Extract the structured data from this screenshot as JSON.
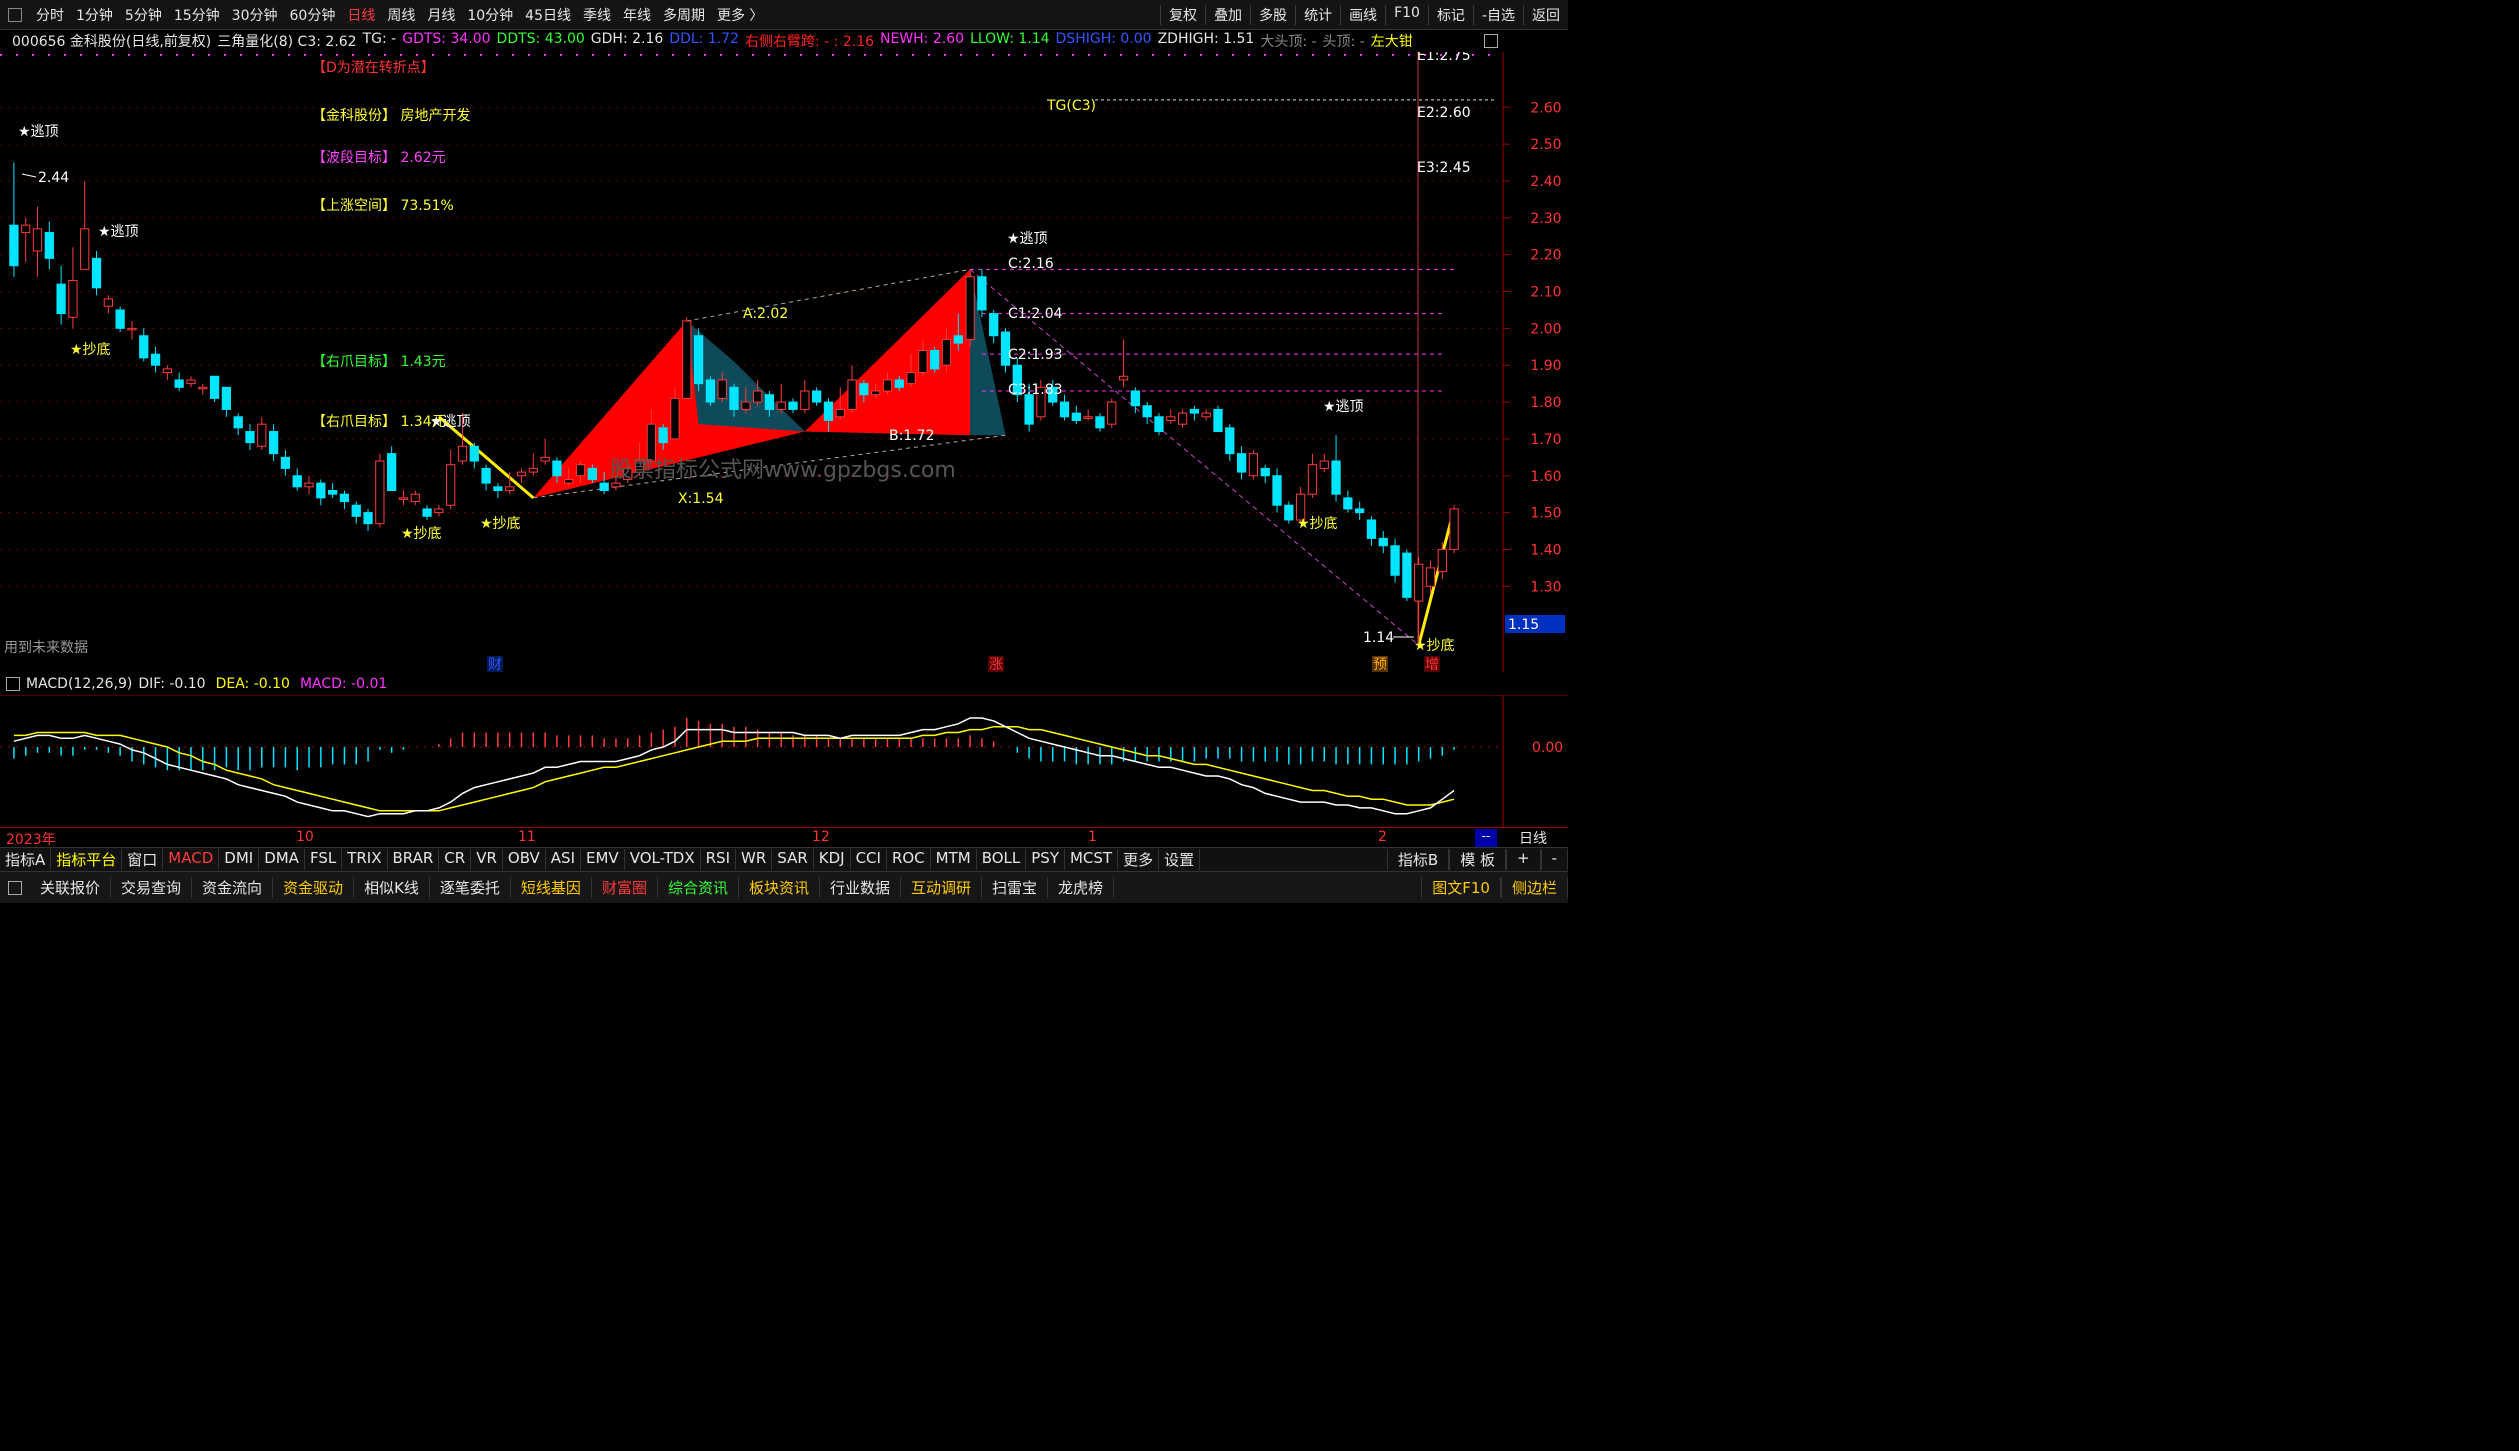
{
  "toolbar": {
    "periods": [
      "分时",
      "1分钟",
      "5分钟",
      "15分钟",
      "30分钟",
      "60分钟",
      "日线",
      "周线",
      "月线",
      "10分钟",
      "45日线",
      "季线",
      "年线",
      "多周期",
      "更多 〉"
    ],
    "active": "日线",
    "right": [
      "复权",
      "叠加",
      "多股",
      "统计",
      "画线",
      "F10",
      "标记",
      "-自选",
      "返回"
    ]
  },
  "info": [
    {
      "t": "000656 金科股份(日线,前复权)",
      "c": "#e6e6e6"
    },
    {
      "t": "三角量化(8) C3: 2.62",
      "c": "#e6e6e6"
    },
    {
      "t": "TG: -",
      "c": "#e6e6e6"
    },
    {
      "t": "GDTS: 34.00",
      "c": "#ff33ff"
    },
    {
      "t": "DDTS: 43.00",
      "c": "#33ff33"
    },
    {
      "t": "GDH: 2.16",
      "c": "#e6e6e6"
    },
    {
      "t": "DDL: 1.72",
      "c": "#3355ff"
    },
    {
      "t": "右侧右臂跨: - : 2.16",
      "c": "#ff2222"
    },
    {
      "t": "NEWH: 2.60",
      "c": "#ff33ff"
    },
    {
      "t": "LLOW: 1.14",
      "c": "#33ff33"
    },
    {
      "t": "DSHIGH: 0.00",
      "c": "#3355ff"
    },
    {
      "t": "ZDHIGH: 1.51",
      "c": "#e6e6e6"
    },
    {
      "t": "大头顶: -",
      "c": "#888888"
    },
    {
      "t": "头顶: -",
      "c": "#888888"
    },
    {
      "t": "左大钳",
      "c": "#ffff00"
    }
  ],
  "textlabels": [
    {
      "t": "【D为潜在转折点】",
      "c": "#ff3333"
    },
    {
      "t": "【金科股份】 房地产开发",
      "c": "#ffff33"
    },
    {
      "t": "【波段目标】 2.62元",
      "c": "#ff44ff"
    },
    {
      "t": "【上涨空间】 73.51%",
      "c": "#ffff33"
    },
    {
      "t": "【右爪目标】 1.43元",
      "c": "#33ff33"
    },
    {
      "t": "【右爪目标】 1.34元",
      "c": "#ffff33"
    }
  ],
  "future_note": "用到未来数据",
  "watermark": "股票指标公式网www.gpzbgs.com",
  "signals": {
    "top": "★逃顶",
    "bottom": "★抄底"
  },
  "marks": [
    "财",
    "涨",
    "预",
    "增"
  ],
  "points": {
    "X": "X:1.54",
    "A": "A:2.02",
    "B": "B:1.72",
    "C": "C:2.16",
    "C1": "C1:2.04",
    "C2": "C2:1.93",
    "C3": "C3:1.83",
    "TG": "TG(C3)",
    "E2": "E2:2.60",
    "E3": "E3:2.45",
    "hi": "2.44",
    "lo": "1.14",
    "E1": "E1:2.75"
  },
  "price_box": "1.15",
  "macd": {
    "label": "MACD(12,26,9)",
    "dif": "DIF: -0.10",
    "dea": "DEA: -0.10",
    "macd": "MACD: -0.01",
    "ytick": "0.00"
  },
  "dates": [
    "2023年",
    "10",
    "11",
    "12",
    "1",
    "2"
  ],
  "date_right": "日线",
  "date_right_small": "--",
  "indicators": [
    "指标A",
    "指标平台",
    "窗口",
    "MACD",
    "DMI",
    "DMA",
    "FSL",
    "TRIX",
    "BRAR",
    "CR",
    "VR",
    "OBV",
    "ASI",
    "EMV",
    "VOL-TDX",
    "RSI",
    "WR",
    "SAR",
    "KDJ",
    "CCI",
    "ROC",
    "MTM",
    "BOLL",
    "PSY",
    "MCST",
    "更多",
    "设置"
  ],
  "indicators_right": [
    "指标B",
    "模 板",
    "+",
    "-"
  ],
  "functions": [
    "关联报价",
    "交易查询",
    "资金流向",
    "资金驱动",
    "相似K线",
    "逐笔委托",
    "短线基因",
    "财富圈",
    "综合资讯",
    "板块资讯",
    "行业数据",
    "互动调研",
    "扫雷宝",
    "龙虎榜"
  ],
  "functions_right": [
    "图文F10",
    "侧边栏"
  ],
  "chart_data": {
    "type": "candlestick",
    "title": "000656 金科股份(日线,前复权)",
    "ylim": [
      1.1,
      2.75
    ],
    "yticks": [
      1.3,
      1.4,
      1.5,
      1.6,
      1.7,
      1.8,
      1.9,
      2.0,
      2.1,
      2.2,
      2.3,
      2.4,
      2.5,
      2.6
    ],
    "candles": [
      [
        2.28,
        2.17,
        2.45,
        2.14
      ],
      [
        2.26,
        2.28,
        2.3,
        2.18
      ],
      [
        2.21,
        2.27,
        2.33,
        2.14
      ],
      [
        2.26,
        2.19,
        2.29,
        2.16
      ],
      [
        2.12,
        2.04,
        2.17,
        2.01
      ],
      [
        2.03,
        2.13,
        2.22,
        2.0
      ],
      [
        2.16,
        2.27,
        2.4,
        2.16
      ],
      [
        2.19,
        2.11,
        2.21,
        2.09
      ],
      [
        2.06,
        2.08,
        2.09,
        2.04
      ],
      [
        2.05,
        2.0,
        2.06,
        1.99
      ],
      [
        2.0,
        2.0,
        2.02,
        1.97
      ],
      [
        1.98,
        1.92,
        2.0,
        1.91
      ],
      [
        1.93,
        1.9,
        1.95,
        1.88
      ],
      [
        1.88,
        1.89,
        1.9,
        1.86
      ],
      [
        1.86,
        1.84,
        1.88,
        1.83
      ],
      [
        1.85,
        1.86,
        1.87,
        1.84
      ],
      [
        1.84,
        1.84,
        1.85,
        1.82
      ],
      [
        1.87,
        1.81,
        1.87,
        1.8
      ],
      [
        1.84,
        1.78,
        1.84,
        1.76
      ],
      [
        1.76,
        1.73,
        1.77,
        1.71
      ],
      [
        1.72,
        1.69,
        1.74,
        1.67
      ],
      [
        1.68,
        1.74,
        1.76,
        1.67
      ],
      [
        1.72,
        1.66,
        1.74,
        1.64
      ],
      [
        1.65,
        1.62,
        1.67,
        1.6
      ],
      [
        1.6,
        1.57,
        1.62,
        1.56
      ],
      [
        1.57,
        1.58,
        1.6,
        1.55
      ],
      [
        1.58,
        1.54,
        1.59,
        1.52
      ],
      [
        1.56,
        1.55,
        1.58,
        1.54
      ],
      [
        1.55,
        1.53,
        1.56,
        1.51
      ],
      [
        1.52,
        1.49,
        1.53,
        1.47
      ],
      [
        1.5,
        1.47,
        1.51,
        1.45
      ],
      [
        1.47,
        1.64,
        1.66,
        1.46
      ],
      [
        1.66,
        1.56,
        1.68,
        1.56
      ],
      [
        1.54,
        1.54,
        1.56,
        1.52
      ],
      [
        1.53,
        1.55,
        1.56,
        1.52
      ],
      [
        1.51,
        1.49,
        1.52,
        1.48
      ],
      [
        1.5,
        1.51,
        1.52,
        1.49
      ],
      [
        1.52,
        1.63,
        1.67,
        1.51
      ],
      [
        1.64,
        1.68,
        1.77,
        1.63
      ],
      [
        1.68,
        1.64,
        1.69,
        1.62
      ],
      [
        1.62,
        1.58,
        1.63,
        1.56
      ],
      [
        1.57,
        1.56,
        1.58,
        1.54
      ],
      [
        1.56,
        1.57,
        1.61,
        1.55
      ],
      [
        1.6,
        1.61,
        1.62,
        1.58
      ],
      [
        1.61,
        1.62,
        1.66,
        1.6
      ],
      [
        1.64,
        1.65,
        1.7,
        1.63
      ],
      [
        1.64,
        1.6,
        1.65,
        1.58
      ],
      [
        1.58,
        1.59,
        1.62,
        1.57
      ],
      [
        1.6,
        1.63,
        1.64,
        1.58
      ],
      [
        1.62,
        1.59,
        1.63,
        1.58
      ],
      [
        1.58,
        1.56,
        1.61,
        1.55
      ],
      [
        1.57,
        1.58,
        1.6,
        1.56
      ],
      [
        1.59,
        1.62,
        1.64,
        1.58
      ],
      [
        1.61,
        1.64,
        1.69,
        1.6
      ],
      [
        1.64,
        1.74,
        1.78,
        1.64
      ],
      [
        1.73,
        1.69,
        1.74,
        1.67
      ],
      [
        1.7,
        1.81,
        1.84,
        1.7
      ],
      [
        1.81,
        2.02,
        2.03,
        1.81
      ],
      [
        1.98,
        1.85,
        2.0,
        1.83
      ],
      [
        1.86,
        1.8,
        1.87,
        1.79
      ],
      [
        1.81,
        1.86,
        1.88,
        1.8
      ],
      [
        1.84,
        1.78,
        1.85,
        1.76
      ],
      [
        1.78,
        1.8,
        1.84,
        1.77
      ],
      [
        1.8,
        1.83,
        1.86,
        1.79
      ],
      [
        1.82,
        1.78,
        1.83,
        1.76
      ],
      [
        1.78,
        1.8,
        1.85,
        1.77
      ],
      [
        1.8,
        1.78,
        1.81,
        1.77
      ],
      [
        1.78,
        1.83,
        1.86,
        1.77
      ],
      [
        1.83,
        1.8,
        1.84,
        1.79
      ],
      [
        1.8,
        1.75,
        1.81,
        1.72
      ],
      [
        1.76,
        1.78,
        1.84,
        1.75
      ],
      [
        1.78,
        1.86,
        1.9,
        1.77
      ],
      [
        1.85,
        1.82,
        1.86,
        1.8
      ],
      [
        1.82,
        1.83,
        1.85,
        1.81
      ],
      [
        1.83,
        1.86,
        1.88,
        1.82
      ],
      [
        1.86,
        1.84,
        1.87,
        1.83
      ],
      [
        1.85,
        1.88,
        1.93,
        1.84
      ],
      [
        1.88,
        1.94,
        1.97,
        1.87
      ],
      [
        1.94,
        1.89,
        1.95,
        1.88
      ],
      [
        1.9,
        1.97,
        2.0,
        1.88
      ],
      [
        1.98,
        1.96,
        2.04,
        1.94
      ],
      [
        1.97,
        2.14,
        2.16,
        1.95
      ],
      [
        2.14,
        2.05,
        2.16,
        2.03
      ],
      [
        2.04,
        1.98,
        2.05,
        1.96
      ],
      [
        1.99,
        1.9,
        2.0,
        1.88
      ],
      [
        1.9,
        1.82,
        1.92,
        1.8
      ],
      [
        1.82,
        1.74,
        1.85,
        1.72
      ],
      [
        1.76,
        1.84,
        1.86,
        1.75
      ],
      [
        1.84,
        1.8,
        1.86,
        1.79
      ],
      [
        1.8,
        1.76,
        1.82,
        1.75
      ],
      [
        1.77,
        1.75,
        1.79,
        1.74
      ],
      [
        1.76,
        1.76,
        1.78,
        1.75
      ],
      [
        1.76,
        1.73,
        1.77,
        1.72
      ],
      [
        1.74,
        1.8,
        1.81,
        1.73
      ],
      [
        1.86,
        1.87,
        1.97,
        1.84
      ],
      [
        1.83,
        1.79,
        1.84,
        1.77
      ],
      [
        1.79,
        1.76,
        1.8,
        1.74
      ],
      [
        1.76,
        1.72,
        1.77,
        1.71
      ],
      [
        1.75,
        1.76,
        1.78,
        1.74
      ],
      [
        1.74,
        1.77,
        1.78,
        1.73
      ],
      [
        1.78,
        1.77,
        1.79,
        1.75
      ],
      [
        1.76,
        1.77,
        1.78,
        1.75
      ],
      [
        1.78,
        1.72,
        1.79,
        1.72
      ],
      [
        1.73,
        1.66,
        1.74,
        1.64
      ],
      [
        1.66,
        1.61,
        1.68,
        1.59
      ],
      [
        1.6,
        1.66,
        1.67,
        1.59
      ],
      [
        1.62,
        1.6,
        1.63,
        1.58
      ],
      [
        1.6,
        1.52,
        1.62,
        1.5
      ],
      [
        1.52,
        1.48,
        1.53,
        1.47
      ],
      [
        1.48,
        1.55,
        1.57,
        1.47
      ],
      [
        1.55,
        1.63,
        1.66,
        1.54
      ],
      [
        1.62,
        1.64,
        1.66,
        1.61
      ],
      [
        1.64,
        1.55,
        1.71,
        1.53
      ],
      [
        1.54,
        1.51,
        1.56,
        1.5
      ],
      [
        1.51,
        1.5,
        1.53,
        1.48
      ],
      [
        1.48,
        1.43,
        1.49,
        1.41
      ],
      [
        1.43,
        1.41,
        1.45,
        1.39
      ],
      [
        1.41,
        1.33,
        1.43,
        1.31
      ],
      [
        1.39,
        1.27,
        1.4,
        1.26
      ],
      [
        1.26,
        1.36,
        1.38,
        1.14
      ],
      [
        1.3,
        1.35,
        1.37,
        1.28
      ],
      [
        1.34,
        1.4,
        1.42,
        1.32
      ],
      [
        1.4,
        1.51,
        1.52,
        1.39
      ]
    ],
    "macd_hist": [
      -0.04,
      -0.03,
      -0.02,
      -0.02,
      -0.03,
      -0.03,
      -0.01,
      -0.01,
      -0.02,
      -0.03,
      -0.05,
      -0.06,
      -0.07,
      -0.08,
      -0.08,
      -0.08,
      -0.08,
      -0.08,
      -0.07,
      -0.08,
      -0.08,
      -0.07,
      -0.07,
      -0.07,
      -0.08,
      -0.07,
      -0.07,
      -0.06,
      -0.06,
      -0.06,
      -0.05,
      -0.01,
      -0.02,
      -0.01,
      0.0,
      0.0,
      0.01,
      0.03,
      0.05,
      0.05,
      0.05,
      0.05,
      0.05,
      0.05,
      0.05,
      0.05,
      0.04,
      0.04,
      0.04,
      0.04,
      0.03,
      0.03,
      0.03,
      0.04,
      0.05,
      0.06,
      0.07,
      0.1,
      0.09,
      0.08,
      0.08,
      0.07,
      0.07,
      0.06,
      0.05,
      0.05,
      0.04,
      0.04,
      0.04,
      0.03,
      0.03,
      0.03,
      0.03,
      0.03,
      0.03,
      0.03,
      0.03,
      0.03,
      0.03,
      0.03,
      0.03,
      0.04,
      0.03,
      0.02,
      0.0,
      -0.02,
      -0.04,
      -0.05,
      -0.05,
      -0.05,
      -0.06,
      -0.06,
      -0.06,
      -0.06,
      -0.05,
      -0.05,
      -0.05,
      -0.05,
      -0.05,
      -0.05,
      -0.05,
      -0.04,
      -0.04,
      -0.04,
      -0.05,
      -0.05,
      -0.05,
      -0.05,
      -0.06,
      -0.06,
      -0.05,
      -0.05,
      -0.06,
      -0.06,
      -0.06,
      -0.06,
      -0.06,
      -0.06,
      -0.06,
      -0.05,
      -0.04,
      -0.03,
      -0.01
    ],
    "macd_dif": [
      0.02,
      0.03,
      0.04,
      0.04,
      0.03,
      0.03,
      0.04,
      0.03,
      0.02,
      0.01,
      -0.01,
      -0.02,
      -0.04,
      -0.06,
      -0.07,
      -0.08,
      -0.09,
      -0.1,
      -0.11,
      -0.13,
      -0.14,
      -0.15,
      -0.16,
      -0.17,
      -0.19,
      -0.2,
      -0.21,
      -0.22,
      -0.22,
      -0.23,
      -0.24,
      -0.23,
      -0.23,
      -0.23,
      -0.22,
      -0.22,
      -0.21,
      -0.19,
      -0.16,
      -0.14,
      -0.13,
      -0.12,
      -0.11,
      -0.1,
      -0.09,
      -0.07,
      -0.07,
      -0.06,
      -0.05,
      -0.05,
      -0.05,
      -0.05,
      -0.04,
      -0.03,
      -0.01,
      0.0,
      0.02,
      0.06,
      0.06,
      0.06,
      0.06,
      0.05,
      0.05,
      0.05,
      0.05,
      0.05,
      0.05,
      0.04,
      0.04,
      0.04,
      0.03,
      0.04,
      0.04,
      0.04,
      0.04,
      0.04,
      0.05,
      0.06,
      0.06,
      0.07,
      0.08,
      0.1,
      0.1,
      0.09,
      0.07,
      0.05,
      0.03,
      0.02,
      0.01,
      0.0,
      -0.01,
      -0.02,
      -0.03,
      -0.03,
      -0.04,
      -0.05,
      -0.06,
      -0.07,
      -0.07,
      -0.08,
      -0.09,
      -0.1,
      -0.1,
      -0.11,
      -0.13,
      -0.14,
      -0.16,
      -0.17,
      -0.18,
      -0.19,
      -0.19,
      -0.19,
      -0.2,
      -0.2,
      -0.21,
      -0.21,
      -0.22,
      -0.23,
      -0.23,
      -0.22,
      -0.21,
      -0.18,
      -0.15
    ],
    "macd_dea": [
      0.04,
      0.04,
      0.05,
      0.05,
      0.05,
      0.05,
      0.05,
      0.04,
      0.04,
      0.04,
      0.03,
      0.02,
      0.01,
      0.0,
      -0.02,
      -0.03,
      -0.05,
      -0.06,
      -0.08,
      -0.09,
      -0.1,
      -0.11,
      -0.13,
      -0.14,
      -0.15,
      -0.16,
      -0.17,
      -0.18,
      -0.19,
      -0.2,
      -0.21,
      -0.22,
      -0.22,
      -0.22,
      -0.22,
      -0.22,
      -0.22,
      -0.21,
      -0.2,
      -0.19,
      -0.18,
      -0.17,
      -0.16,
      -0.15,
      -0.14,
      -0.12,
      -0.11,
      -0.1,
      -0.09,
      -0.08,
      -0.07,
      -0.07,
      -0.06,
      -0.05,
      -0.04,
      -0.03,
      -0.02,
      -0.01,
      0.0,
      0.01,
      0.02,
      0.02,
      0.02,
      0.03,
      0.03,
      0.03,
      0.03,
      0.03,
      0.03,
      0.03,
      0.03,
      0.03,
      0.03,
      0.03,
      0.03,
      0.03,
      0.03,
      0.04,
      0.04,
      0.05,
      0.05,
      0.06,
      0.06,
      0.07,
      0.07,
      0.07,
      0.06,
      0.06,
      0.05,
      0.04,
      0.03,
      0.02,
      0.01,
      0.0,
      -0.01,
      -0.02,
      -0.03,
      -0.03,
      -0.04,
      -0.05,
      -0.06,
      -0.06,
      -0.07,
      -0.08,
      -0.09,
      -0.1,
      -0.11,
      -0.12,
      -0.13,
      -0.14,
      -0.15,
      -0.15,
      -0.16,
      -0.17,
      -0.17,
      -0.18,
      -0.18,
      -0.19,
      -0.2,
      -0.2,
      -0.2,
      -0.19,
      -0.18
    ]
  }
}
